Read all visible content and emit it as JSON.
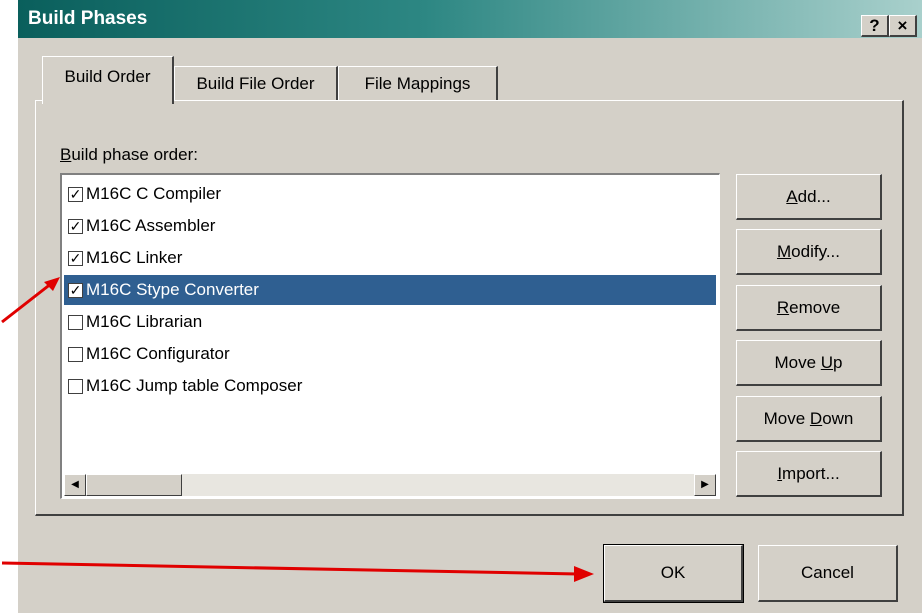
{
  "window": {
    "title": "Build Phases",
    "help_glyph": "?",
    "close_glyph": "×",
    "title_gradient": [
      "#0a5f5c",
      "#a9d0cc"
    ]
  },
  "tabs": [
    {
      "label": "Build Order",
      "active": true
    },
    {
      "label": "Build File Order",
      "active": false
    },
    {
      "label": "File Mappings",
      "active": false
    }
  ],
  "list": {
    "label_key": "B",
    "label_rest": "uild phase order:",
    "items": [
      {
        "label": "M16C C Compiler",
        "checked": true,
        "selected": false
      },
      {
        "label": "M16C Assembler",
        "checked": true,
        "selected": false
      },
      {
        "label": "M16C Linker",
        "checked": true,
        "selected": false
      },
      {
        "label": "M16C Stype Converter",
        "checked": true,
        "selected": true
      },
      {
        "label": "M16C Librarian",
        "checked": false,
        "selected": false
      },
      {
        "label": "M16C Configurator",
        "checked": false,
        "selected": false
      },
      {
        "label": "M16C Jump table Composer",
        "checked": false,
        "selected": false
      }
    ],
    "selection_color": "#2f5f91"
  },
  "side_buttons": [
    {
      "pre": "",
      "key": "A",
      "post": "dd..."
    },
    {
      "pre": "",
      "key": "M",
      "post": "odify..."
    },
    {
      "pre": "",
      "key": "R",
      "post": "emove"
    },
    {
      "pre": "Move ",
      "key": "U",
      "post": "p"
    },
    {
      "pre": "Move ",
      "key": "D",
      "post": "own"
    },
    {
      "pre": "",
      "key": "I",
      "post": "mport..."
    }
  ],
  "bottom_buttons": {
    "ok": "OK",
    "cancel": "Cancel"
  },
  "annotation_color": "#e00000"
}
